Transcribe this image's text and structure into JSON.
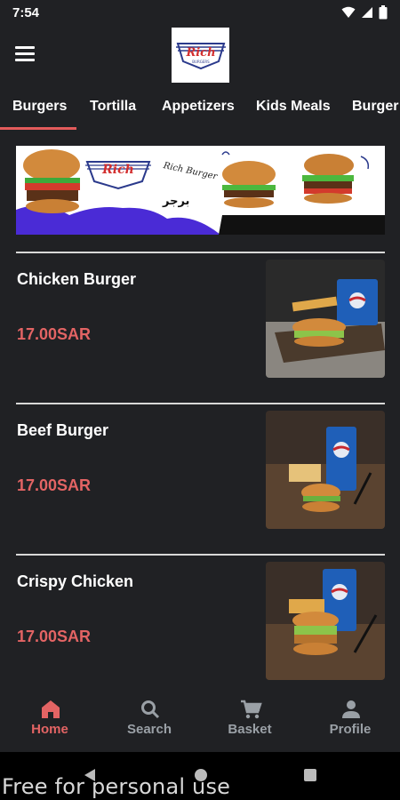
{
  "status_bar": {
    "time": "7:54",
    "icons": [
      "wifi-icon",
      "signal-icon",
      "battery-icon"
    ]
  },
  "app_bar": {
    "menu_icon": "hamburger-menu-icon",
    "logo_text": "Rich",
    "logo_subtext": "BURGERS"
  },
  "tabs": [
    {
      "label": "Burgers",
      "active": true
    },
    {
      "label": "Tortilla",
      "active": false
    },
    {
      "label": "Appetizers",
      "active": false
    },
    {
      "label": "Kids Meals",
      "active": false
    },
    {
      "label": "Burger I",
      "active": false
    }
  ],
  "banner": {
    "handwriting": "Rich Burger",
    "arabic": "برجر",
    "logo_text": "Rich"
  },
  "menu_items": [
    {
      "name": "Chicken Burger",
      "price": "17.00SAR"
    },
    {
      "name": "Beef Burger",
      "price": "17.00SAR"
    },
    {
      "name": "Crispy Chicken",
      "price": "17.00SAR"
    }
  ],
  "bottom_nav": [
    {
      "label": "Home",
      "icon": "home-icon",
      "active": true
    },
    {
      "label": "Search",
      "icon": "search-icon",
      "active": false
    },
    {
      "label": "Basket",
      "icon": "cart-icon",
      "active": false
    },
    {
      "label": "Profile",
      "icon": "person-icon",
      "active": false
    }
  ],
  "watermark": "Free for personal use",
  "colors": {
    "accent": "#e36464",
    "background": "#202124",
    "inactive": "#9aa0a6"
  }
}
